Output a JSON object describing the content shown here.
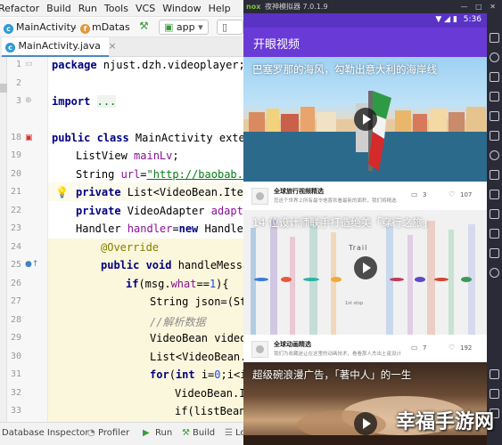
{
  "ide": {
    "menu": [
      "Refactor",
      "Build",
      "Run",
      "Tools",
      "VCS",
      "Window",
      "Help"
    ],
    "breadcrumbs": [
      "MainActivity",
      "mDatas"
    ],
    "run_config": "app",
    "tab": "MainActivity.java",
    "line_numbers": [
      "1",
      "2",
      "3",
      "18",
      "19",
      "20",
      "21",
      "22",
      "23",
      "24",
      "25",
      "26",
      "27",
      "28",
      "29",
      "30",
      "31",
      "32",
      "33",
      "34"
    ],
    "code": {
      "l1_kw": "package",
      "l1_rest": " njust.dzh.videoplayer;",
      "l3_kw": "import",
      "l3_fold": "...",
      "l18_kw": "public class",
      "l18_rest": " MainActivity extend",
      "l19_type": "ListView ",
      "l19_var": "mainLv",
      "l19_end": ";",
      "l20_type": "String ",
      "l20_var": "url",
      "l20_eq": "=",
      "l20_str": "\"http://baobab.ke",
      "l21_kw": "private",
      "l21_rest": " List<VideoBean.Item",
      "l22_kw": "private",
      "l22_type": " VideoAdapter ",
      "l22_var": "adapte",
      "l23_type": "Handler ",
      "l23_var": "handler",
      "l23_eq": "=",
      "l23_kw": "new",
      "l23_rest": " Handler",
      "l24_ann": "@Override",
      "l25_kw": "public void",
      "l25_rest": " handleMessag",
      "l26_kw": "if",
      "l26_a": "(msg.",
      "l26_fld": "what",
      "l26_b": "==",
      "l26_num": "1",
      "l26_c": "){",
      "l27_text": "String json=(St",
      "l28_cmt": "//解析数据",
      "l29_text": "VideoBean videoB",
      "l30_text": "List<VideoBean.",
      "l31_kw": "for",
      "l31_a": "(",
      "l31_kw2": "int",
      "l31_b": " i=",
      "l31_num": "0",
      "l31_c": ";i<i",
      "l32_text": "VideoBean.I",
      "l33_text": "if(listBean"
    },
    "bottom_tools": [
      "Database Inspector",
      "Profiler",
      "Run",
      "Build",
      "Lo"
    ]
  },
  "emulator": {
    "logo": "nox",
    "title": "夜神模拟器 7.0.1.9",
    "window_controls": "— □ ✕",
    "status_time": "5:36",
    "app_title": "开眼视频",
    "videos": [
      {
        "title": "巴塞罗那的海风，勾勒出意大利的海岸线",
        "author": "全球旅行视频精选",
        "desc": "您这个世界上所有最令他喜欢看最新的面积，我们将精选",
        "comments": "3",
        "likes": "107"
      },
      {
        "title": "14 位设计师联手打造绝美「穿行之旅」",
        "art_title": "Trail",
        "art_caption": "1st stop",
        "author": "全球动画精选",
        "desc": "我们为收藏迷让在这里的动画技术，看看那人杰出土诞设计",
        "comments": "7",
        "likes": "192"
      },
      {
        "title": "超级碗浪漫广告，「著中人」的一生"
      }
    ]
  },
  "watermark": "幸福手游网"
}
